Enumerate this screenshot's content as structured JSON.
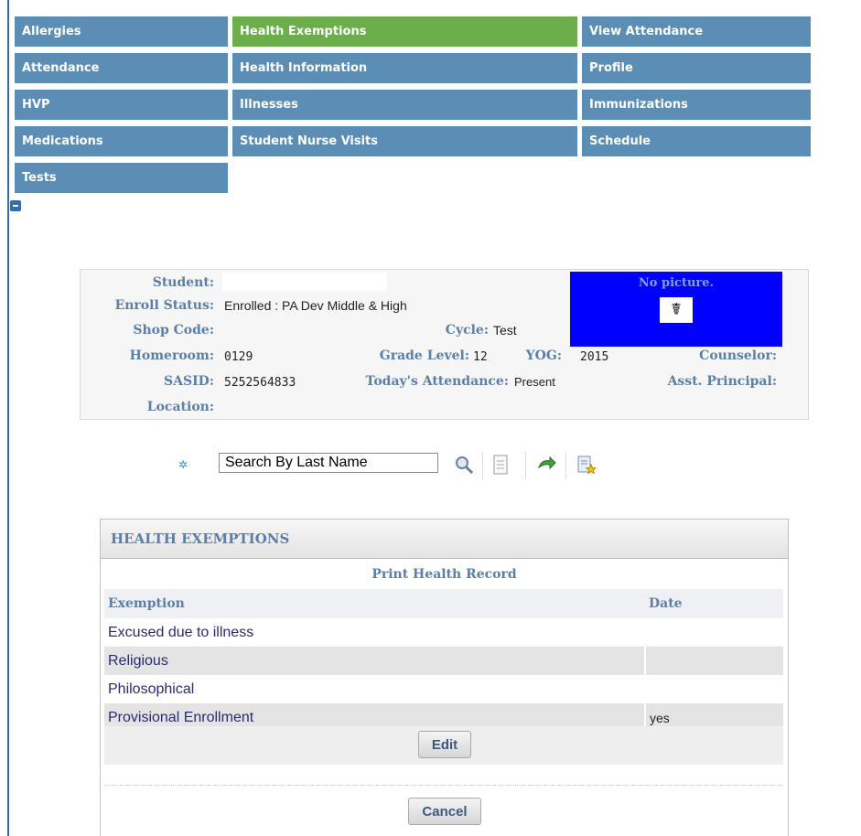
{
  "nav": {
    "items": [
      {
        "label": "Allergies"
      },
      {
        "label": "Health Exemptions"
      },
      {
        "label": "View Attendance"
      },
      {
        "label": "Attendance"
      },
      {
        "label": "Health Information"
      },
      {
        "label": "Profile"
      },
      {
        "label": "HVP"
      },
      {
        "label": "Illnesses"
      },
      {
        "label": "Immunizations"
      },
      {
        "label": "Medications"
      },
      {
        "label": "Student Nurse Visits"
      },
      {
        "label": "Schedule"
      },
      {
        "label": "Tests"
      }
    ],
    "active": "Health Exemptions",
    "active_color": "#6cae4b",
    "item_color": "#5b8db5"
  },
  "student_info": {
    "student_label": "Student:",
    "student_value": "",
    "enroll_label": "Enroll Status:",
    "enroll_value": "Enrolled : PA Dev Middle & High",
    "shop_label": "Shop Code:",
    "cycle_label": "Cycle:",
    "cycle_value": "Test",
    "homeroom_label": "Homeroom:",
    "homeroom_value": "0129",
    "grade_label": "Grade Level:",
    "grade_value": "12",
    "yog_label": "YOG:",
    "yog_value": "2015",
    "counselor_label": "Counselor:",
    "sasid_label": "SASID:",
    "sasid_value": "5252564833",
    "attendance_label": "Today's Attendance:",
    "attendance_value": "Present",
    "asst_label": "Asst. Principal:",
    "location_label": "Location:",
    "photo_text": "No picture.",
    "photo_icon": "caduceus-icon",
    "photo_bg": "#0000ff"
  },
  "toolbar": {
    "search_value": "Search By Last Name",
    "icons": [
      "gear-icon",
      "magnifier-icon",
      "list-icon",
      "arrow-icon",
      "report-icon"
    ]
  },
  "panel": {
    "title": "HEALTH EXEMPTIONS",
    "print_link": "Print Health Record",
    "columns": [
      "Exemption",
      "Date"
    ],
    "rows": [
      {
        "exemption": "Excused due to illness",
        "date": ""
      },
      {
        "exemption": "Religious",
        "date": ""
      },
      {
        "exemption": "Philosophical",
        "date": ""
      },
      {
        "exemption": "Provisional Enrollment",
        "date": "yes"
      }
    ],
    "edit_label": "Edit",
    "cancel_label": "Cancel"
  }
}
